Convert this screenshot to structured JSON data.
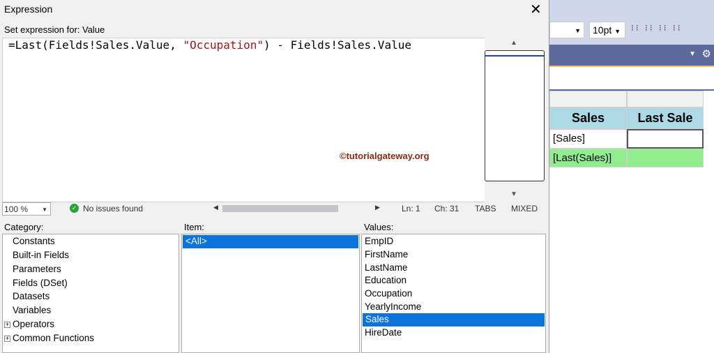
{
  "background": {
    "combo_value": "",
    "font_size": "10pt",
    "headers": [
      "Sales",
      "Last Sale"
    ],
    "row1": "[Sales]",
    "row2": "[Last(Sales)]",
    "header_color": "#add8e6",
    "green": "#90ee90"
  },
  "dialog": {
    "title": "Expression",
    "set_label": "Set expression for: Value",
    "expr_prefix": "=Last(Fields!Sales.Value, ",
    "expr_string": "\"Occupation\"",
    "expr_suffix": ") - Fields!Sales.Value",
    "watermark": "©tutorialgateway.org",
    "zoom": "100 %",
    "issues": "No issues found",
    "ln": "Ln: 1",
    "ch": "Ch: 31",
    "tabs": "TABS",
    "mixed": "MIXED",
    "category_label": "Category:",
    "item_label": "Item:",
    "values_label": "Values:",
    "categories": [
      "Constants",
      "Built-in Fields",
      "Parameters",
      "Fields (DSet)",
      "Datasets",
      "Variables",
      "Operators",
      "Common Functions"
    ],
    "items": [
      "<All>"
    ],
    "values": [
      "EmpID",
      "FirstName",
      "LastName",
      "Education",
      "Occupation",
      "YearlyIncome",
      "Sales",
      "HireDate"
    ],
    "selected_value": "Sales"
  }
}
